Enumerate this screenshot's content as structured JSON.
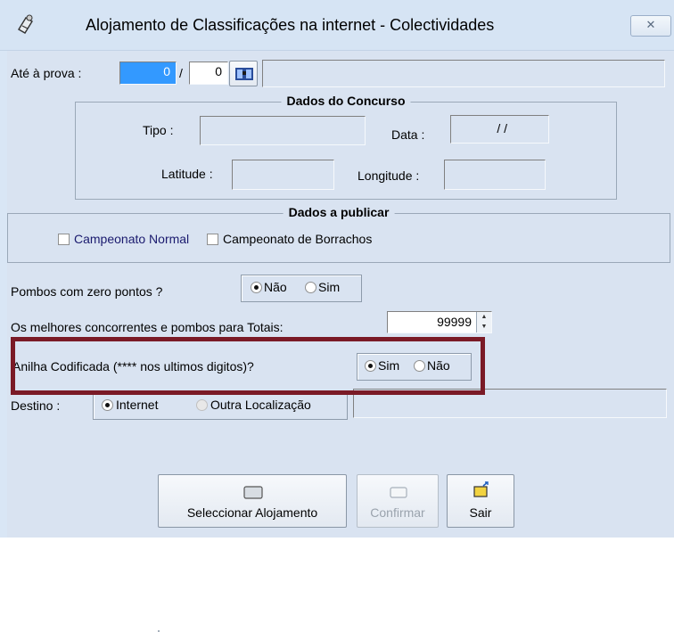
{
  "window": {
    "title": "Alojamento de Classificações na internet - Colectividades",
    "close_label": "ⵈ"
  },
  "prova": {
    "label": "Até à prova :",
    "value1": "0",
    "separator": "/",
    "value2": "0",
    "name_value": ""
  },
  "dados_concurso": {
    "title": "Dados do Concurso",
    "tipo_label": "Tipo :",
    "tipo_value": "",
    "data_label": "Data :",
    "data_value": "/ /",
    "latitude_label": "Latitude :",
    "latitude_value": "",
    "longitude_label": "Longitude :",
    "longitude_value": ""
  },
  "dados_publicar": {
    "title": "Dados a publicar",
    "campeonato_normal": "Campeonato Normal",
    "campeonato_borrachos": "Campeonato de Borrachos"
  },
  "zero_pontos": {
    "label": "Pombos com zero pontos ?",
    "opt_no": "Não",
    "opt_yes": "Sim",
    "selected": "Não"
  },
  "melhores": {
    "label": "Os melhores concorrentes e pombos para Totais:",
    "value": "99999"
  },
  "anilha": {
    "label": "Anilha Codificada (**** nos ultimos digitos)?",
    "opt_yes": "Sim",
    "opt_no": "Não",
    "selected": "Sim"
  },
  "destino": {
    "label": "Destino :",
    "opt_internet": "Internet",
    "opt_outra": "Outra Localização",
    "selected": "Internet",
    "path_value": ""
  },
  "buttons": {
    "seleccionar": "Seleccionar Alojamento",
    "confirmar": "Confirmar",
    "sair": "Sair"
  },
  "colors": {
    "highlight": "#7a1a26",
    "selection": "#3399ff",
    "client_bg": "#d9e3f1"
  }
}
